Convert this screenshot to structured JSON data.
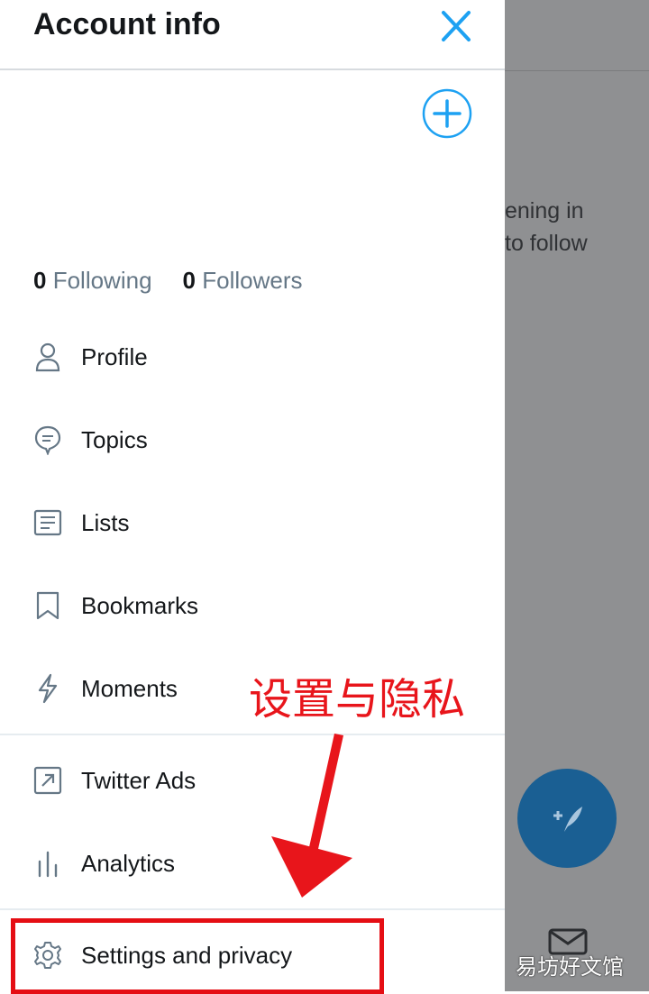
{
  "drawer": {
    "title": "Account info",
    "counts": {
      "following_count": "0",
      "following_label": "Following",
      "followers_count": "0",
      "followers_label": "Followers"
    },
    "menu": [
      {
        "label": "Profile",
        "icon": "person-icon"
      },
      {
        "label": "Topics",
        "icon": "topics-icon"
      },
      {
        "label": "Lists",
        "icon": "lists-icon"
      },
      {
        "label": "Bookmarks",
        "icon": "bookmark-icon"
      },
      {
        "label": "Moments",
        "icon": "lightning-icon"
      }
    ],
    "secondary": [
      {
        "label": "Twitter Ads",
        "icon": "external-arrow-icon"
      },
      {
        "label": "Analytics",
        "icon": "bar-chart-icon"
      }
    ],
    "settings": {
      "label": "Settings and privacy",
      "icon": "gear-icon"
    }
  },
  "background": {
    "text_line1": "ening in",
    "text_line2": "to follow"
  },
  "annotation": {
    "label": "设置与隐私",
    "watermark": "易坊好文馆"
  },
  "colors": {
    "accent": "#1da1f2",
    "text": "#14171a",
    "muted": "#657786",
    "annotation_red": "#e50e14",
    "overlay": "#8f9092",
    "fab": "#1a5f93"
  }
}
